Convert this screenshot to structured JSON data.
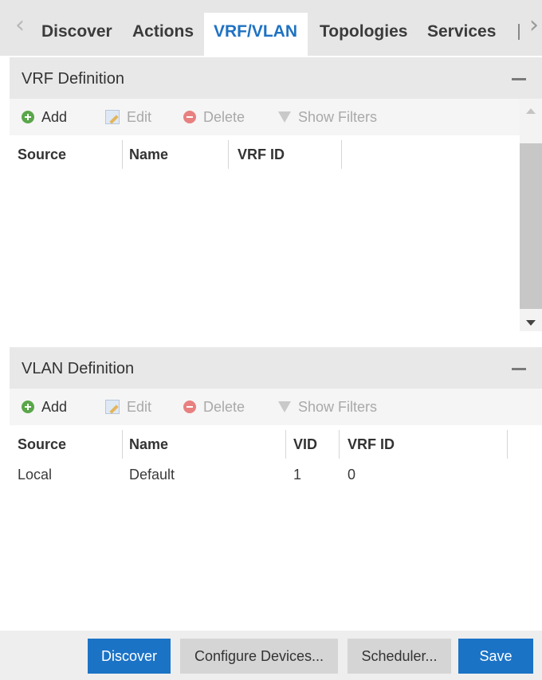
{
  "tabs": {
    "items": [
      {
        "label": "Discover"
      },
      {
        "label": "Actions"
      },
      {
        "label": "VRF/VLAN",
        "active": true
      },
      {
        "label": "Topologies"
      },
      {
        "label": "Services"
      }
    ],
    "scroll_left_icon": "chevron-left-icon",
    "scroll_right_icon": "chevron-right-icon"
  },
  "vrf": {
    "title": "VRF Definition",
    "toolbar": {
      "add": "Add",
      "edit": "Edit",
      "delete": "Delete",
      "show_filters": "Show Filters"
    },
    "columns": [
      "Source",
      "Name",
      "VRF ID"
    ],
    "rows": []
  },
  "vlan": {
    "title": "VLAN Definition",
    "toolbar": {
      "add": "Add",
      "edit": "Edit",
      "delete": "Delete",
      "show_filters": "Show Filters"
    },
    "columns": [
      "Source",
      "Name",
      "VID",
      "VRF ID"
    ],
    "rows": [
      {
        "source": "Local",
        "name": "Default",
        "vid": "1",
        "vrf_id": "0"
      }
    ]
  },
  "footer": {
    "discover": "Discover",
    "configure_devices": "Configure Devices...",
    "scheduler": "Scheduler...",
    "save": "Save"
  },
  "colors": {
    "accent": "#1f72c2",
    "primary_button": "#1b73c6",
    "add_icon": "#5aa64a",
    "delete_icon": "#e88080"
  }
}
